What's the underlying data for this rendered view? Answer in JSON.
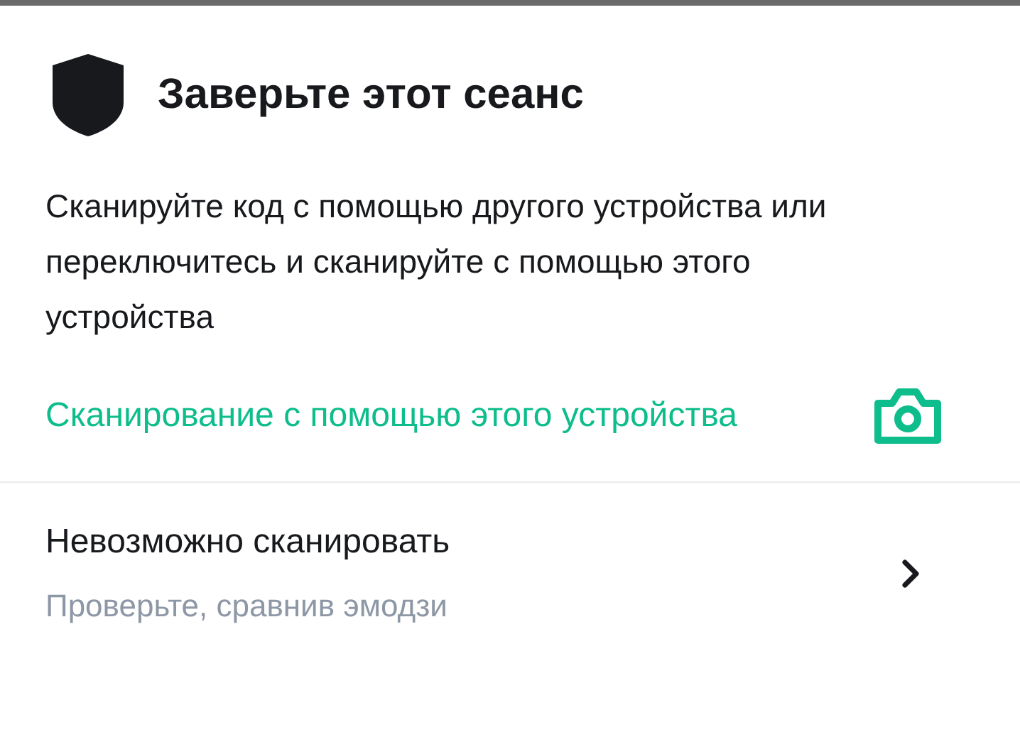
{
  "title": "Заверьте этот сеанс",
  "description": "Сканируйте код с помощью другого устройства или переключитесь и сканируйте с помощью этого устройства",
  "scan_action": {
    "label": "Сканирование с помощью этого устройства"
  },
  "cannot_scan": {
    "title": "Невозможно сканировать",
    "subtitle": "Проверьте, сравнив эмодзи"
  }
}
